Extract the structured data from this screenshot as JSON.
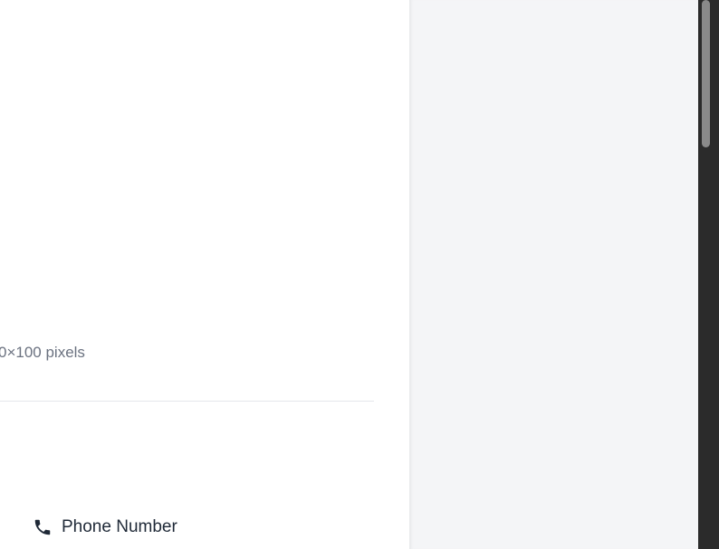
{
  "upload": {
    "size_hint": "0×100 pixels"
  },
  "contact": {
    "phone_label": "Phone Number",
    "phone_icon": "phone-icon"
  },
  "colors": {
    "side_panel_bg": "#f4f5f7",
    "divider": "#e5e7eb",
    "hint_text": "#6b7280",
    "label_text": "#1f2937",
    "scrollbar_track": "#2b2b2b",
    "scrollbar_thumb": "#8a8a8a"
  }
}
